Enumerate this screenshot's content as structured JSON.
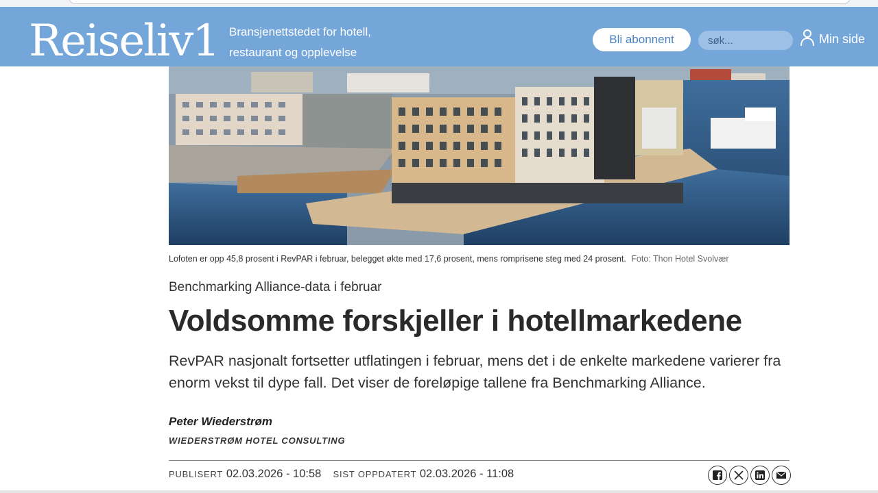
{
  "header": {
    "logo": "Reiseliv1",
    "tagline_line1": "Bransjenettstedet for hotell,",
    "tagline_line2": "restaurant og opplevelse",
    "subscribe_label": "Bli abonnent",
    "search_placeholder": "søk...",
    "my_page_label": "Min side",
    "accent_color": "#74a6d9"
  },
  "hero": {
    "image_description_icon": "photo",
    "caption": "Lofoten er opp 45,8 prosent i RevPAR i februar, belegget økte med 17,6 prosent, mens romprisene steg med 24 prosent.",
    "credit": "Foto: Thon Hotel Svolvær"
  },
  "article": {
    "kicker": "Benchmarking Alliance-data i februar",
    "headline": "Voldsomme forskjeller i hotellmarkedene",
    "lead": "RevPAR nasjonalt fortsetter utflatingen i februar, mens det i de enkelte markedene varierer fra enorm vekst til dype fall. Det viser de foreløpige tallene fra Benchmarking Alliance.",
    "author": "Peter Wiederstrøm",
    "organization": "WIEDERSTRØM HOTEL CONSULTING",
    "published_label": "PUBLISERT",
    "published_value": "02.03.2026 - 10:58",
    "updated_label": "SIST OPPDATERT",
    "updated_value": "02.03.2026 - 11:08"
  },
  "share": {
    "icons": [
      "facebook-icon",
      "x-icon",
      "linkedin-icon",
      "email-icon"
    ]
  }
}
